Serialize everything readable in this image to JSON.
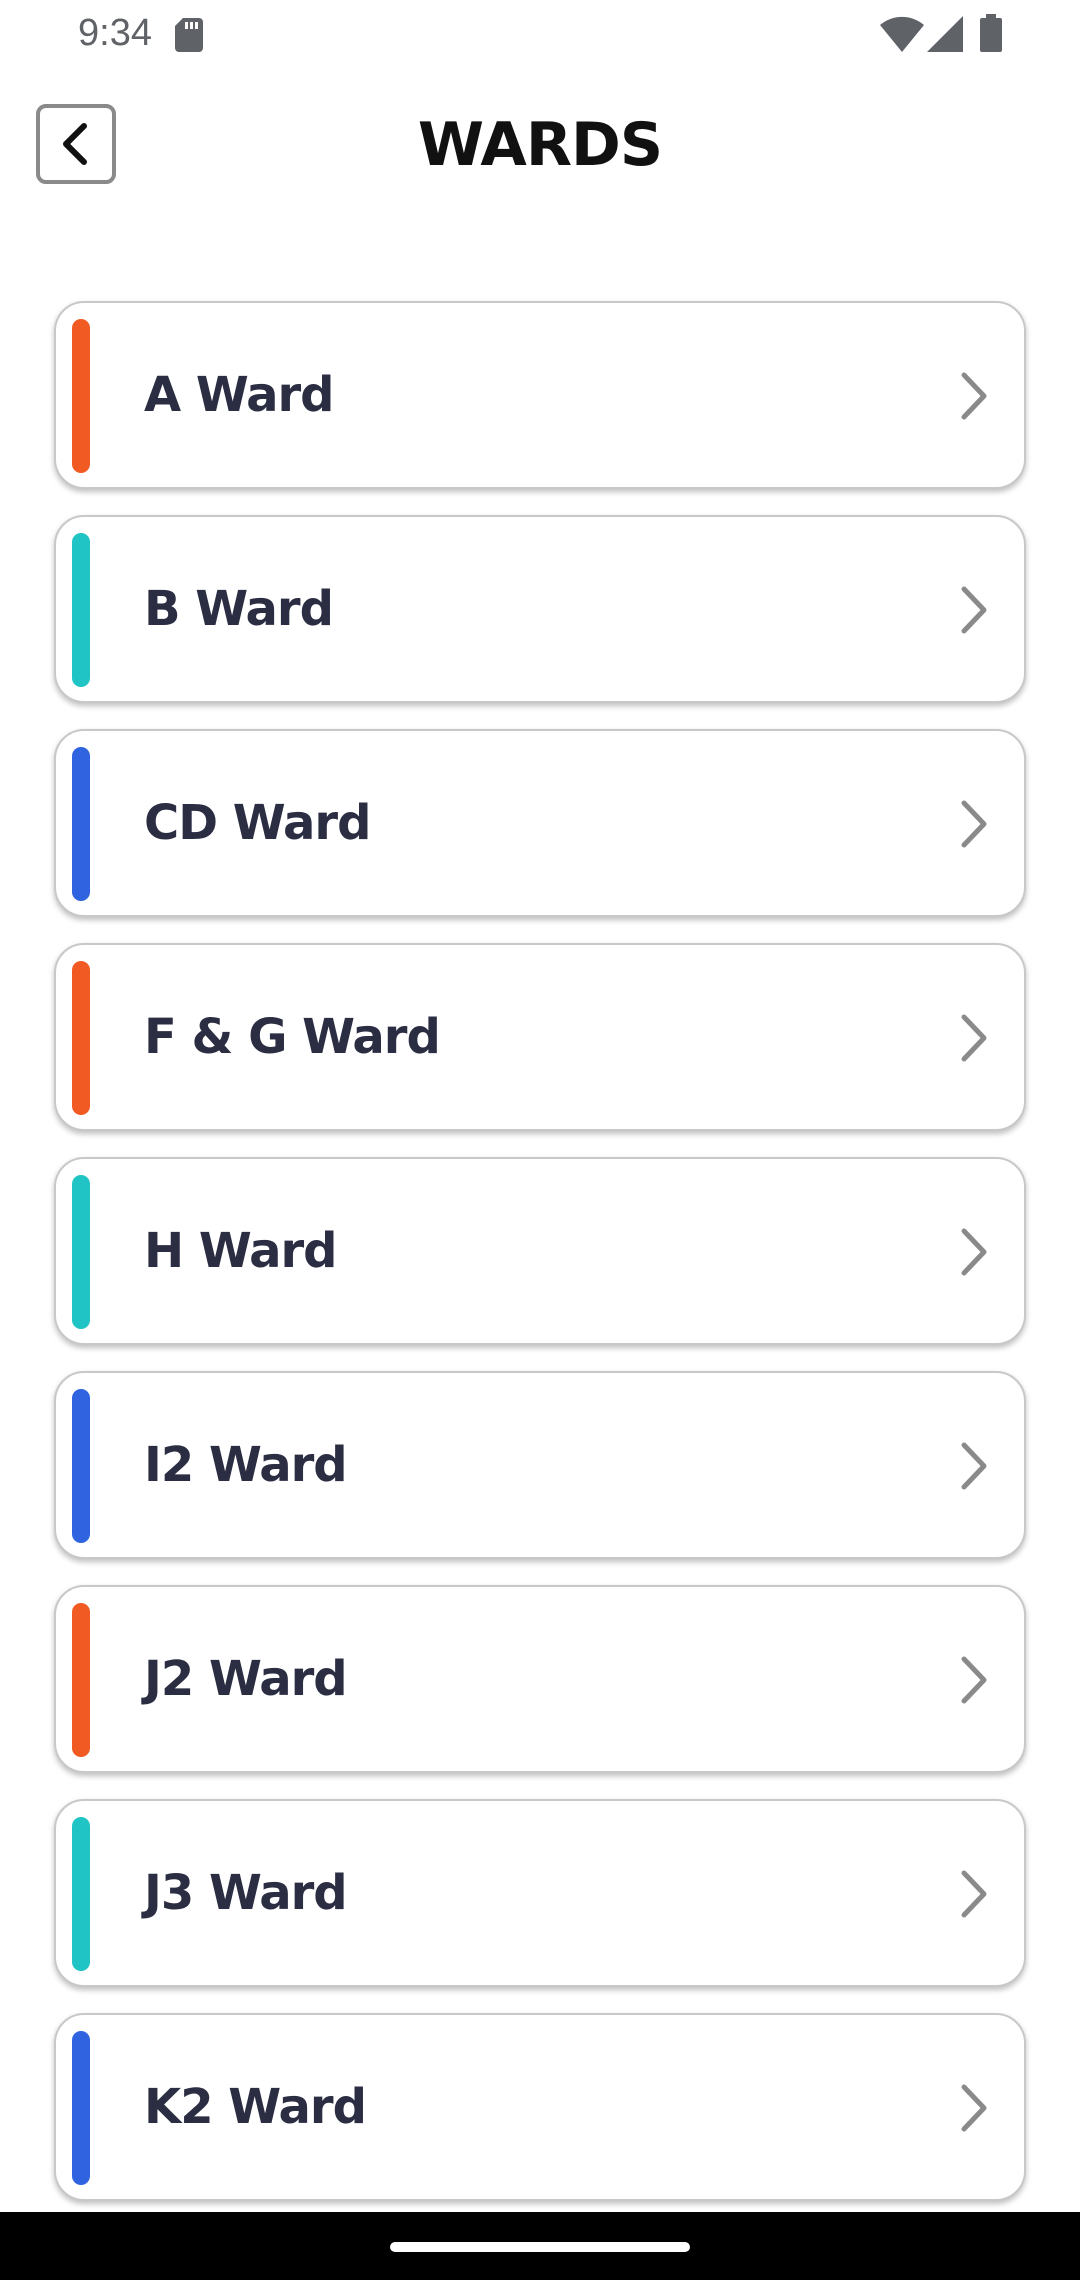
{
  "status_bar": {
    "time": "9:34"
  },
  "header": {
    "title": "WARDS",
    "back_icon": "chevron-left-icon"
  },
  "colors": {
    "orange": "#f25a24",
    "teal": "#21c4c4",
    "blue": "#2f63e0",
    "text": "#2b2d42",
    "chevron": "#8a8a8a"
  },
  "wards": [
    {
      "label": "A Ward",
      "accent": "#f25a24"
    },
    {
      "label": "B Ward",
      "accent": "#21c4c4"
    },
    {
      "label": "CD Ward",
      "accent": "#2f63e0"
    },
    {
      "label": "F & G Ward",
      "accent": "#f25a24"
    },
    {
      "label": "H Ward",
      "accent": "#21c4c4"
    },
    {
      "label": "I2 Ward",
      "accent": "#2f63e0"
    },
    {
      "label": "J2 Ward",
      "accent": "#f25a24"
    },
    {
      "label": "J3 Ward",
      "accent": "#21c4c4"
    },
    {
      "label": "K2 Ward",
      "accent": "#2f63e0"
    }
  ]
}
